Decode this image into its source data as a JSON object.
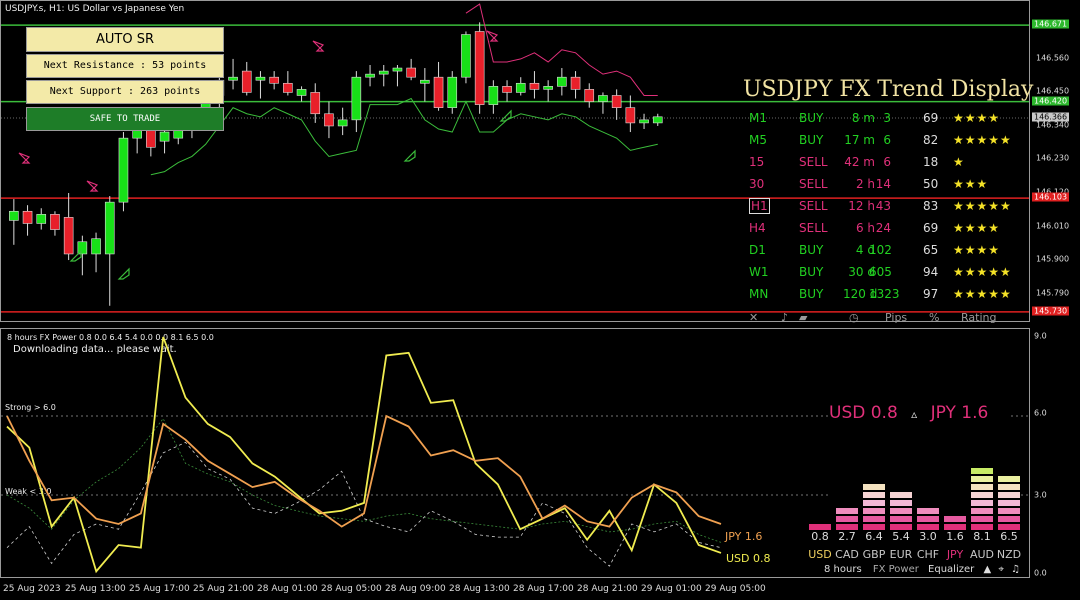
{
  "window": {
    "title": "USDJPY.s, H1:  US Dollar vs Japanese Yen"
  },
  "auto_sr": {
    "title": "AUTO SR",
    "next_resistance": "Next Resistance : 53 points",
    "next_support": "Next Support : 263 points",
    "status": "SAFE TO TRADE"
  },
  "price_scale": {
    "labels": [
      "146.560",
      "146.450",
      "146.340",
      "146.230",
      "146.120",
      "146.010",
      "145.900",
      "145.790"
    ],
    "highlighted": [
      {
        "label": "146.671",
        "color": "#2db82d"
      },
      {
        "label": "146.420",
        "color": "#2db82d"
      },
      {
        "label": "146.366",
        "color": "#c8c8c8"
      },
      {
        "label": "146.103",
        "color": "#e02020"
      },
      {
        "label": "145.730",
        "color": "#e02020"
      }
    ]
  },
  "trend_display": {
    "title": "USDJPY FX Trend Display",
    "rows": [
      {
        "tf": "M1",
        "dir": "BUY",
        "dur": "8 m",
        "pips": "3",
        "pct": "69",
        "stars": "★★★★",
        "color": "#22d022"
      },
      {
        "tf": "M5",
        "dir": "BUY",
        "dur": "17 m",
        "pips": "6",
        "pct": "82",
        "stars": "★★★★★",
        "color": "#22d022"
      },
      {
        "tf": "15",
        "dir": "SELL",
        "dur": "42 m",
        "pips": "6",
        "pct": "18",
        "stars": "★",
        "color": "#e0307a"
      },
      {
        "tf": "30",
        "dir": "SELL",
        "dur": "2 h",
        "pips": "14",
        "pct": "50",
        "stars": "★★★",
        "color": "#e0307a"
      },
      {
        "tf": "H1",
        "dir": "SELL",
        "dur": "12 h",
        "pips": "43",
        "pct": "83",
        "stars": "★★★★★",
        "color": "#e0307a"
      },
      {
        "tf": "H4",
        "dir": "SELL",
        "dur": "6 h",
        "pips": "24",
        "pct": "69",
        "stars": "★★★★",
        "color": "#e0307a"
      },
      {
        "tf": "D1",
        "dir": "BUY",
        "dur": "4 d",
        "pips": "102",
        "pct": "65",
        "stars": "★★★★",
        "color": "#22d022"
      },
      {
        "tf": "W1",
        "dir": "BUY",
        "dur": "30 d",
        "pips": "605",
        "pct": "94",
        "stars": "★★★★★",
        "color": "#22d022"
      },
      {
        "tf": "MN",
        "dir": "BUY",
        "dur": "120 d",
        "pips": "1323",
        "pct": "97",
        "stars": "★★★★★",
        "color": "#22d022"
      }
    ],
    "footer": {
      "close": "✕",
      "music": "♪",
      "pips": "Pips",
      "pct": "%",
      "rating": "Rating"
    }
  },
  "indicator": {
    "header": "8 hours FX Power 0.8 0.0 6.4 5.4 0.0 0.0 8.1 6.5 0.0",
    "status": "Downloading data... please wait.",
    "strong_label": "Strong > 6.0",
    "weak_label": "Weak < 3.0",
    "scale": [
      "9.0",
      "6.0",
      "3.0",
      "0.0"
    ],
    "jpy_label": "JPY 1.6",
    "usd_label": "USD 0.8",
    "pair_usd": "USD 0.8",
    "pair_arrow": "▵",
    "pair_jpy": "JPY 1.6"
  },
  "equalizer": {
    "values": [
      "0.8",
      "2.7",
      "6.4",
      "5.4",
      "3.0",
      "1.6",
      "8.1",
      "6.5"
    ],
    "currencies": [
      {
        "code": "USD",
        "color": "#f0d060"
      },
      {
        "code": "CAD",
        "color": "#c8c8c8"
      },
      {
        "code": "GBP",
        "color": "#c8c8c8"
      },
      {
        "code": "EUR",
        "color": "#c8c8c8"
      },
      {
        "code": "CHF",
        "color": "#c8c8c8"
      },
      {
        "code": "JPY",
        "color": "#e0307a"
      },
      {
        "code": "AUD",
        "color": "#c8c8c8"
      },
      {
        "code": "NZD",
        "color": "#c8c8c8"
      }
    ],
    "levels": [
      0.8,
      2.7,
      6.4,
      5.4,
      3.0,
      1.6,
      8.1,
      6.5
    ],
    "footer": {
      "period": "8 hours",
      "name": "FX Power",
      "mode": "Equalizer",
      "ctrl1": "▲",
      "ctrl2": "⌖",
      "ctrl3": "♫"
    }
  },
  "time_axis": [
    "25 Aug 2023",
    "25 Aug 13:00",
    "25 Aug 17:00",
    "25 Aug 21:00",
    "28 Aug 01:00",
    "28 Aug 05:00",
    "28 Aug 09:00",
    "28 Aug 13:00",
    "28 Aug 17:00",
    "28 Aug 21:00",
    "29 Aug 01:00",
    "29 Aug 05:00"
  ],
  "chart_data": {
    "type": "candlestick",
    "symbol": "USDJPY.s",
    "timeframe": "H1",
    "ylim": [
      145.73,
      146.75
    ],
    "levels": {
      "resistance_1": 146.671,
      "resistance_2": 146.42,
      "support_1": 146.103,
      "support_2": 145.73,
      "current": 146.366
    },
    "candles": [
      {
        "o": 146.03,
        "h": 146.1,
        "l": 145.95,
        "c": 146.06
      },
      {
        "o": 146.06,
        "h": 146.08,
        "l": 145.98,
        "c": 146.02
      },
      {
        "o": 146.02,
        "h": 146.07,
        "l": 146.0,
        "c": 146.05
      },
      {
        "o": 146.05,
        "h": 146.06,
        "l": 145.98,
        "c": 146.0
      },
      {
        "o": 146.04,
        "h": 146.12,
        "l": 145.9,
        "c": 145.92
      },
      {
        "o": 145.92,
        "h": 145.98,
        "l": 145.85,
        "c": 145.96
      },
      {
        "o": 145.92,
        "h": 145.99,
        "l": 145.86,
        "c": 145.97
      },
      {
        "o": 145.92,
        "h": 146.11,
        "l": 145.75,
        "c": 146.09
      },
      {
        "o": 146.09,
        "h": 146.32,
        "l": 146.06,
        "c": 146.3
      },
      {
        "o": 146.3,
        "h": 146.4,
        "l": 146.25,
        "c": 146.34
      },
      {
        "o": 146.34,
        "h": 146.38,
        "l": 146.24,
        "c": 146.27
      },
      {
        "o": 146.29,
        "h": 146.33,
        "l": 146.25,
        "c": 146.32
      },
      {
        "o": 146.3,
        "h": 146.36,
        "l": 146.28,
        "c": 146.35
      },
      {
        "o": 146.33,
        "h": 146.39,
        "l": 146.3,
        "c": 146.36
      },
      {
        "o": 146.36,
        "h": 146.46,
        "l": 146.34,
        "c": 146.44
      },
      {
        "o": 146.44,
        "h": 146.52,
        "l": 146.4,
        "c": 146.49
      },
      {
        "o": 146.49,
        "h": 146.56,
        "l": 146.46,
        "c": 146.5
      },
      {
        "o": 146.52,
        "h": 146.55,
        "l": 146.44,
        "c": 146.45
      },
      {
        "o": 146.49,
        "h": 146.52,
        "l": 146.43,
        "c": 146.5
      },
      {
        "o": 146.5,
        "h": 146.52,
        "l": 146.46,
        "c": 146.48
      },
      {
        "o": 146.48,
        "h": 146.52,
        "l": 146.44,
        "c": 146.45
      },
      {
        "o": 146.44,
        "h": 146.47,
        "l": 146.42,
        "c": 146.46
      },
      {
        "o": 146.45,
        "h": 146.48,
        "l": 146.35,
        "c": 146.38
      },
      {
        "o": 146.38,
        "h": 146.42,
        "l": 146.3,
        "c": 146.34
      },
      {
        "o": 146.34,
        "h": 146.4,
        "l": 146.31,
        "c": 146.36
      },
      {
        "o": 146.36,
        "h": 146.52,
        "l": 146.32,
        "c": 146.5
      },
      {
        "o": 146.5,
        "h": 146.54,
        "l": 146.47,
        "c": 146.51
      },
      {
        "o": 146.51,
        "h": 146.54,
        "l": 146.47,
        "c": 146.52
      },
      {
        "o": 146.52,
        "h": 146.54,
        "l": 146.47,
        "c": 146.53
      },
      {
        "o": 146.53,
        "h": 146.56,
        "l": 146.49,
        "c": 146.5
      },
      {
        "o": 146.48,
        "h": 146.53,
        "l": 146.42,
        "c": 146.49
      },
      {
        "o": 146.5,
        "h": 146.55,
        "l": 146.39,
        "c": 146.4
      },
      {
        "o": 146.4,
        "h": 146.52,
        "l": 146.38,
        "c": 146.5
      },
      {
        "o": 146.5,
        "h": 146.65,
        "l": 146.48,
        "c": 146.64
      },
      {
        "o": 146.65,
        "h": 146.68,
        "l": 146.38,
        "c": 146.41
      },
      {
        "o": 146.41,
        "h": 146.49,
        "l": 146.38,
        "c": 146.47
      },
      {
        "o": 146.47,
        "h": 146.49,
        "l": 146.42,
        "c": 146.45
      },
      {
        "o": 146.45,
        "h": 146.5,
        "l": 146.44,
        "c": 146.48
      },
      {
        "o": 146.48,
        "h": 146.52,
        "l": 146.43,
        "c": 146.46
      },
      {
        "o": 146.46,
        "h": 146.49,
        "l": 146.42,
        "c": 146.47
      },
      {
        "o": 146.47,
        "h": 146.53,
        "l": 146.44,
        "c": 146.5
      },
      {
        "o": 146.5,
        "h": 146.52,
        "l": 146.43,
        "c": 146.46
      },
      {
        "o": 146.46,
        "h": 146.48,
        "l": 146.4,
        "c": 146.42
      },
      {
        "o": 146.42,
        "h": 146.45,
        "l": 146.38,
        "c": 146.44
      },
      {
        "o": 146.44,
        "h": 146.46,
        "l": 146.36,
        "c": 146.4
      },
      {
        "o": 146.4,
        "h": 146.44,
        "l": 146.32,
        "c": 146.35
      },
      {
        "o": 146.35,
        "h": 146.38,
        "l": 146.33,
        "c": 146.36
      },
      {
        "o": 146.35,
        "h": 146.38,
        "l": 146.34,
        "c": 146.37
      }
    ],
    "power_series": [
      {
        "name": "JPY",
        "color": "#f0a050",
        "values": [
          6.0,
          4.3,
          2.8,
          2.9,
          2.1,
          1.9,
          2.3,
          5.7,
          5.1,
          4.3,
          3.8,
          3.3,
          3.5,
          2.9,
          2.4,
          1.8,
          2.3,
          6.0,
          5.6,
          4.5,
          4.7,
          4.3,
          4.4,
          3.7,
          2.1,
          2.6,
          2.0,
          1.8,
          2.9,
          3.4,
          3.1,
          2.2,
          1.9
        ]
      },
      {
        "name": "USD",
        "color": "#f0ec50",
        "values": [
          5.6,
          4.8,
          1.8,
          2.9,
          0.1,
          1.1,
          1.0,
          9.0,
          6.7,
          5.7,
          5.2,
          4.2,
          3.7,
          3.0,
          2.3,
          2.4,
          2.7,
          8.3,
          8.4,
          6.5,
          6.6,
          4.2,
          3.4,
          1.7,
          2.1,
          2.5,
          1.3,
          2.4,
          0.9,
          3.4,
          2.7,
          1.1,
          0.8
        ]
      },
      {
        "name": "AUX",
        "color": "#cfcfcf",
        "values": [
          1.0,
          1.8,
          0.4,
          1.5,
          1.9,
          1.7,
          3.1,
          4.6,
          5.0,
          4.0,
          3.6,
          2.5,
          2.3,
          2.7,
          3.2,
          3.9,
          2.1,
          1.8,
          1.6,
          2.4,
          2.0,
          1.5,
          1.4,
          1.4,
          2.7,
          2.3,
          1.0,
          0.3,
          1.9,
          1.6,
          1.9,
          1.2,
          1.0
        ]
      },
      {
        "name": "AUX2",
        "color": "#3a8a3a",
        "values": [
          3.0,
          2.5,
          1.7,
          2.8,
          3.5,
          4.0,
          4.8,
          5.9,
          4.2,
          3.8,
          3.5,
          3.0,
          2.6,
          2.4,
          2.2,
          2.1,
          2.0,
          2.2,
          2.3,
          2.1,
          2.0,
          1.9,
          1.8,
          1.7,
          1.9,
          2.0,
          1.8,
          1.6,
          1.7,
          1.9,
          2.0,
          1.5,
          1.2
        ]
      }
    ]
  }
}
